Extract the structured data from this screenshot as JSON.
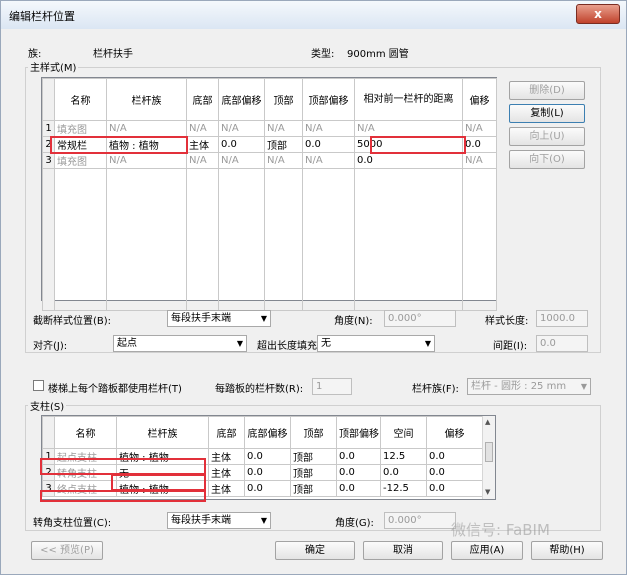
{
  "window": {
    "title": "编辑栏杆位置",
    "close_label": "x"
  },
  "family": {
    "label": "族:",
    "value": "栏杆扶手",
    "type_label": "类型:",
    "type_value": "900mm 圆管"
  },
  "main_pattern": {
    "title": "主样式(M)",
    "headers": [
      "名称",
      "栏杆族",
      "底部",
      "底部偏移",
      "顶部",
      "顶部偏移",
      "相对前一栏杆的距离",
      "偏移"
    ],
    "rows": [
      {
        "n": "1",
        "c": [
          "填充图",
          "N/A",
          "N/A",
          "N/A",
          "N/A",
          "N/A",
          "N/A",
          "N/A"
        ]
      },
      {
        "n": "2",
        "c": [
          "常规栏",
          "植物 : 植物",
          "主体",
          "0.0",
          "顶部",
          "0.0",
          "5000",
          "0.0"
        ]
      },
      {
        "n": "3",
        "c": [
          "填充图",
          "N/A",
          "N/A",
          "N/A",
          "N/A",
          "N/A",
          "0.0",
          "N/A"
        ]
      }
    ],
    "buttons": {
      "delete": "删除(D)",
      "copy": "复制(L)",
      "up": "向上(U)",
      "down": "向下(O)"
    }
  },
  "break": {
    "break_label": "截断样式位置(B):",
    "break_value": "每段扶手末端",
    "angle_label": "角度(N):",
    "angle_value": "0.000°",
    "length_label": "样式长度:",
    "length_value": "1000.0",
    "justify_label": "对齐(J):",
    "justify_value": "起点",
    "excess_label": "超出长度填充(E):",
    "excess_value": "无",
    "spacing_label": "间距(I):",
    "spacing_value": "0.0"
  },
  "tread": {
    "checkbox_label": "楼梯上每个踏板都使用栏杆(T)",
    "count_label": "每踏板的栏杆数(R):",
    "count_value": "1",
    "family_label": "栏杆族(F):",
    "family_value": "栏杆 - 圆形 : 25 mm"
  },
  "posts": {
    "title": "支柱(S)",
    "headers": [
      "名称",
      "栏杆族",
      "底部",
      "底部偏移",
      "顶部",
      "顶部偏移",
      "空间",
      "偏移"
    ],
    "rows": [
      {
        "n": "1",
        "c": [
          "起点支柱",
          "植物 : 植物",
          "主体",
          "0.0",
          "顶部",
          "0.0",
          "12.5",
          "0.0"
        ]
      },
      {
        "n": "2",
        "c": [
          "转角支柱",
          "无",
          "主体",
          "0.0",
          "顶部",
          "0.0",
          "0.0",
          "0.0"
        ]
      },
      {
        "n": "3",
        "c": [
          "终点支柱",
          "植物 : 植物",
          "主体",
          "0.0",
          "顶部",
          "0.0",
          "-12.5",
          "0.0"
        ]
      }
    ],
    "corner_label": "转角支柱位置(C):",
    "corner_value": "每段扶手末端",
    "angle_label": "角度(G):",
    "angle_value": "0.000°"
  },
  "footer": {
    "preview": "<< 预览(P)",
    "ok": "确定",
    "cancel": "取消",
    "apply": "应用(A)",
    "help": "帮助(H)"
  },
  "watermark": "微信号: FaBIM"
}
